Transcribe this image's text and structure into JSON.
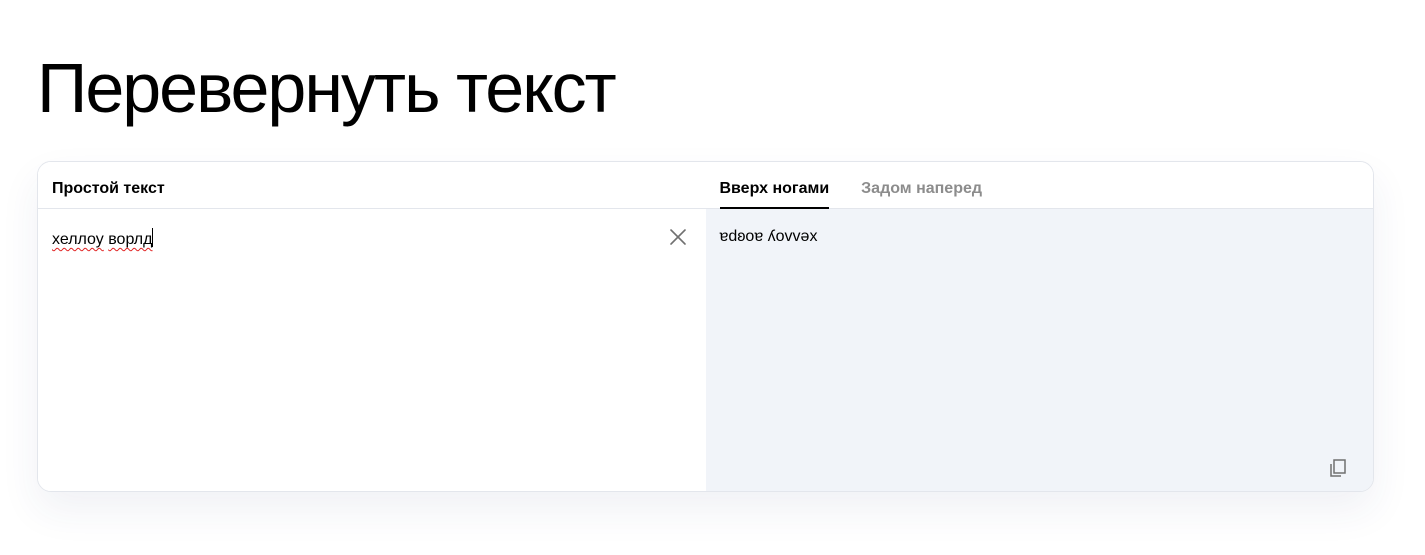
{
  "page": {
    "title": "Перевернуть текст"
  },
  "input_panel": {
    "label": "Простой текст",
    "words": [
      "хеллоу",
      "ворлд"
    ],
    "clear_icon": "close-icon"
  },
  "output_panel": {
    "tabs": [
      {
        "label": "Вверх ногами",
        "active": true
      },
      {
        "label": "Задом наперед",
        "active": false
      }
    ],
    "value": "ɐdʚoɐ ʎovvǝx",
    "copy_icon": "copy-icon"
  },
  "colors": {
    "output_background": "#f1f4f9",
    "inactive_tab": "#8c8c8c",
    "border": "#e3e6ec",
    "spellcheck_underline": "#e02020"
  }
}
